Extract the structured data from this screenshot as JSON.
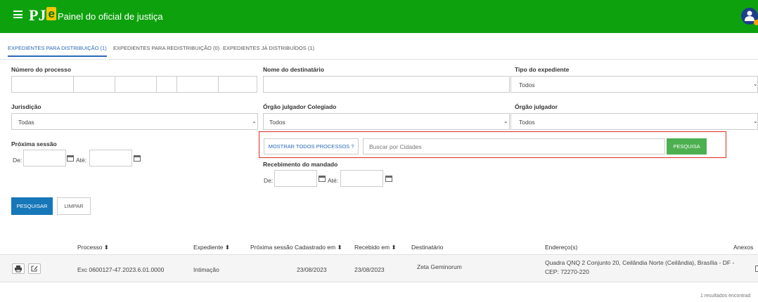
{
  "header": {
    "logo_main": "PJ",
    "logo_accent": "e",
    "title": "Painel do oficial de justiça"
  },
  "tabs": [
    {
      "label": "EXPEDIENTES PARA DISTRIBUIÇÃO (1)"
    },
    {
      "label": "EXPEDIENTES PARA REDISTRIBUIÇÃO (0)"
    },
    {
      "label": "EXPEDIENTES JÁ DISTRIBUÍDOS (1)"
    }
  ],
  "filters": {
    "numero_processo": "Número do processo",
    "nome_destinatario": "Nome do destinatário",
    "tipo_expediente": {
      "label": "Tipo do expediente",
      "value": "Todos"
    },
    "jurisdicao": {
      "label": "Jurisdição",
      "value": "Todas"
    },
    "orgao_colegiado": {
      "label": "Órgão julgador Colegiado",
      "value": "Todos"
    },
    "orgao_julgador": {
      "label": "Órgão julgador",
      "value": "Todos"
    },
    "proxima_sessao": {
      "label": "Próxima sessão",
      "de": "De:",
      "ate": "Até:"
    },
    "recebimento": {
      "label": "Recebimento do mandado",
      "de": "De:",
      "ate": "Até:"
    },
    "mostrar_todos": "MOSTRAR TODOS PROCESSOS ?",
    "buscar_cidades_placeholder": "Buscar por Cidades",
    "pesquisa_btn": "PESQUISA",
    "pesquisar_btn": "PESQUISAR",
    "limpar_btn": "LIMPAR"
  },
  "table": {
    "headers": {
      "processo": "Processo ⬍",
      "expediente": "Expediente ⬍",
      "proxima_sessao": "Próxima sessão",
      "cadastrado": "Cadastrado em ⬍",
      "recebido": "Recebido em ⬍",
      "destinatario": "Destinatário",
      "endereco": "Endereço(s)",
      "anexos": "Anexos"
    },
    "row": {
      "processo": "Exc 0600127-47.2023.6.01.0000",
      "expediente": "Intimação",
      "cadastrado": "23/08/2023",
      "recebido": "23/08/2023",
      "destinatario": "Zeta Geminorum",
      "endereco_1": "Quadra QNQ 2 Conjunto 20, Ceilândia Norte (Ceilândia), Brasília - DF -",
      "endereco_2": "CEP: 72270-220"
    },
    "footer": "1 resultados encontrad"
  }
}
